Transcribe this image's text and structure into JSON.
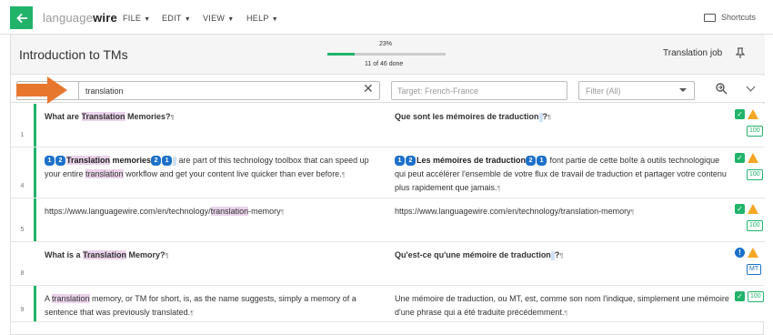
{
  "app": {
    "logo_light": "language",
    "logo_bold": "wire",
    "menus": [
      "FILE",
      "EDIT",
      "VIEW",
      "HELP"
    ],
    "shortcuts": "Shortcuts"
  },
  "header": {
    "title": "Introduction to TMs",
    "progress_pct": "23%",
    "progress_fraction": 0.23,
    "progress_text": "11 of 46 done",
    "job_type": "Translation job"
  },
  "filters": {
    "id_placeholder": "ID",
    "source_search": "translation",
    "target_placeholder": "Target: French-France",
    "filter_value": "Filter (All)"
  },
  "segments": [
    {
      "num": "1",
      "source": [
        "What are ",
        "Translation",
        " Memories?"
      ],
      "target": "Que sont les mémoires de traduction",
      "target_end": "?",
      "match": "100"
    },
    {
      "num": "4",
      "source_a": "Translation",
      "source_b": " memories",
      "source_c": " are part of this technology toolbox that can speed up your entire ",
      "source_d": "translation",
      "source_e": " workflow and get your content live quicker than ever before.",
      "target_a": "Les mémoires de traduction",
      "target_b": " font partie de cette boîte à outils technologique qui peut accélérer l'ensemble de votre flux de travail de traduction et partager votre contenu plus rapidement que jamais.",
      "match": "100"
    },
    {
      "num": "5",
      "source_a": "https://www.languagewire.com/en/technology/",
      "source_b": "translation",
      "source_c": "-memory",
      "target": "https://www.languagewire.com/en/technology/translation-memory",
      "match": "100"
    },
    {
      "num": "8",
      "source_a": "What is a ",
      "source_b": "Translation",
      "source_c": " Memory?",
      "target": "Qu'est-ce qu'une mémoire de traduction",
      "target_end": "?",
      "match": "MT"
    },
    {
      "num": "9",
      "source_a": "A ",
      "source_b": "translation",
      "source_c": " memory, or TM for short, is, as the name suggests, simply a memory of a sentence that was previously translated.",
      "target": "Une mémoire de traduction, ou MT, est, comme son nom l'indique, simplement une mémoire d'une phrase qui a été traduite précédemment.",
      "match": "100"
    }
  ],
  "tags": [
    "1",
    "2"
  ],
  "pilcrow": "¶",
  "colors": {
    "accent": "#21b36a",
    "tag": "#1d71c9",
    "warning": "#f5a623",
    "highlight": "#ead3ea",
    "arrow": "#e8772e"
  }
}
